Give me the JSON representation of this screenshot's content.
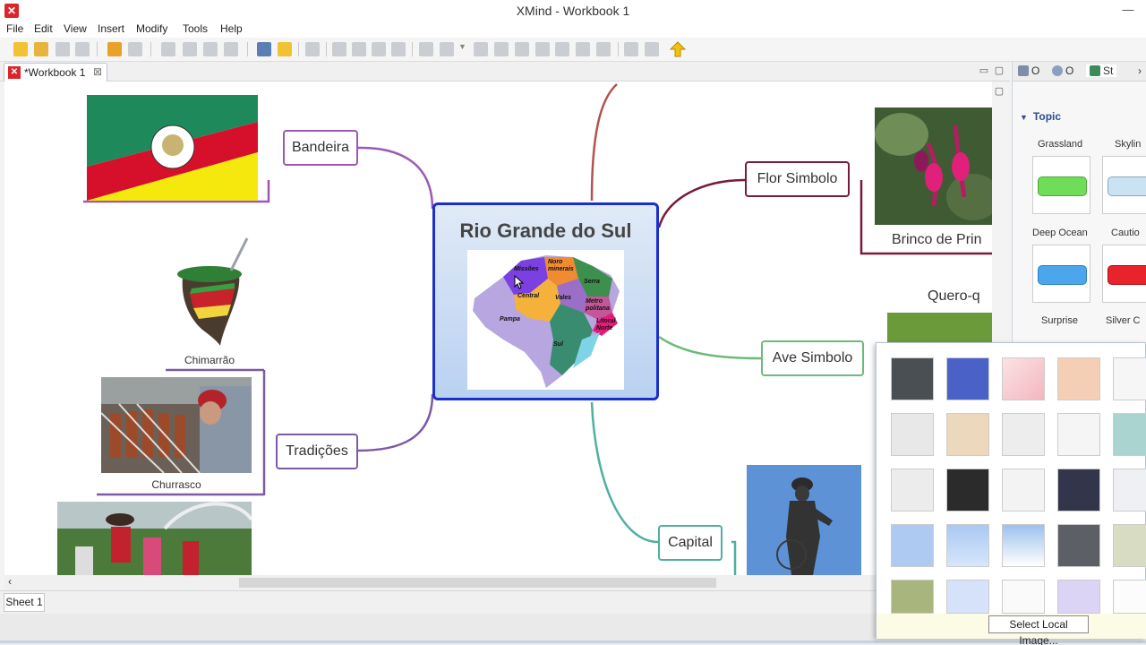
{
  "window": {
    "title": "XMind - Workbook 1",
    "minimize": "—",
    "maximize": "☐"
  },
  "menu": [
    "File",
    "Edit",
    "View",
    "Insert",
    "Modify",
    "Tools",
    "Help"
  ],
  "editor_tab": {
    "label": "*Workbook 1",
    "close": "⊠"
  },
  "sheet_tab": "Sheet 1",
  "central": {
    "title": "Rio Grande do Sul",
    "map_labels": [
      "Missões",
      "Noro minerais",
      "Serra",
      "Central",
      "Vales",
      "Metro politana",
      "Litoral Norte",
      "Pampa",
      "Sul"
    ]
  },
  "nodes": {
    "bandeira": "Bandeira",
    "tradicoes": "Tradições",
    "flor": "Flor Simbolo",
    "ave": "Ave Simbolo",
    "capital": "Capital"
  },
  "captions": {
    "chimarrao": "Chimarrão",
    "churrasco": "Churrasco",
    "brinco": "Brinco de Prin",
    "quero": "Quero-q"
  },
  "right_panel": {
    "tabs": [
      "O",
      "O",
      "St"
    ],
    "section": "Topic",
    "styles": [
      "Grassland",
      "Skylin",
      "Deep Ocean",
      "Cautio",
      "Surprise",
      "Silver C"
    ],
    "colors": {
      "grass": "#6fdc5a",
      "sky": "#c9e3f3",
      "ocean": "#4ba6ec",
      "caution": "#e8232c"
    }
  },
  "popup": {
    "button": "Select Local Image..."
  }
}
